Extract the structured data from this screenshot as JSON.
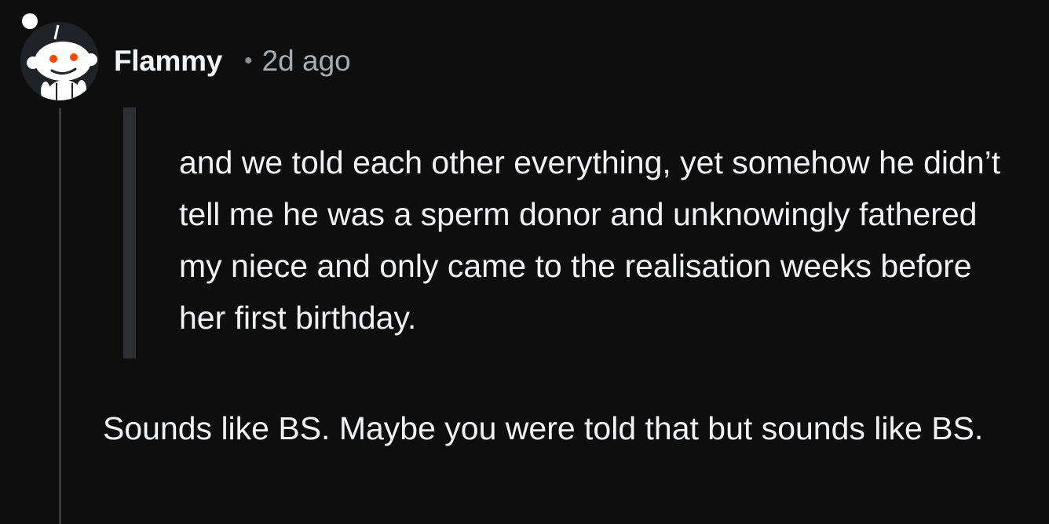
{
  "comment": {
    "username": "Flammy",
    "separator": "•",
    "timestamp": "2d ago",
    "quote": "and we told each other everything, yet somehow he didn’t tell me he was a sperm donor and unknowingly fathered my niece and only came to the realisation weeks before her first birthday.",
    "body": "Sounds like BS. Maybe you were told that but sounds like BS.",
    "avatar_icon": "snoo-avatar-icon"
  },
  "colors": {
    "background": "#0e0e0f",
    "text": "#f2f3f5",
    "muted": "#a8abb0",
    "quote_bar": "#2c2f33",
    "thread_line": "#3a3d40",
    "snoo_eye": "#ff4500"
  }
}
